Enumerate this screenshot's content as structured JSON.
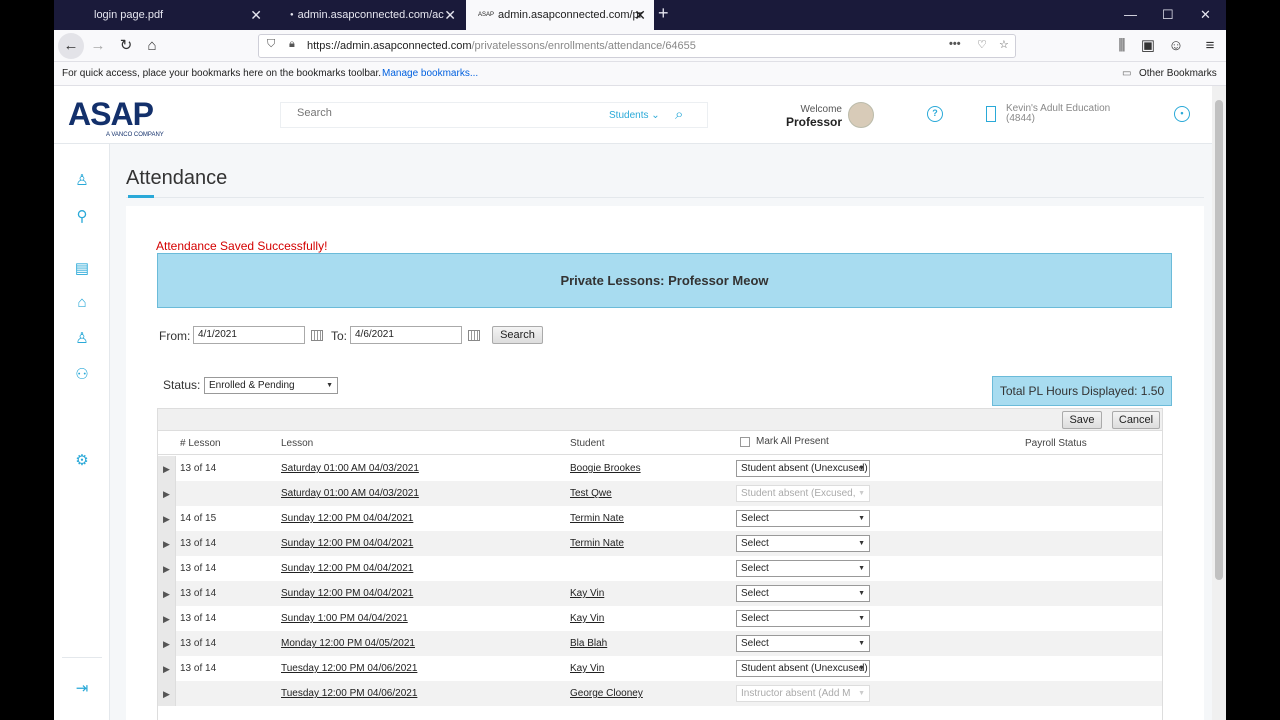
{
  "browser": {
    "tabs": [
      {
        "label": "login page.pdf"
      },
      {
        "label": "admin.asapconnected.com/ac"
      },
      {
        "label": "admin.asapconnected.com/pr"
      }
    ],
    "url_domain": "https://admin.asapconnected.com",
    "url_path": "/privatelessons/enrollments/attendance/64655",
    "bookmarks_text": "For quick access, place your bookmarks here on the bookmarks toolbar.",
    "bookmarks_link": "Manage bookmarks...",
    "other_bookmarks": "Other Bookmarks"
  },
  "header": {
    "logo_main": "ASAP",
    "logo_sub": "A VANCO COMPANY",
    "search_placeholder": "Search",
    "search_category": "Students",
    "welcome_label": "Welcome",
    "user_name": "Professor",
    "org_name": "Kevin's Adult Education",
    "org_id": "(4844)"
  },
  "page": {
    "title": "Attendance",
    "saved_message": "Attendance Saved Successfully!",
    "banner": "Private Lessons: Professor Meow",
    "from_label": "From:",
    "from_value": "4/1/2021",
    "to_label": "To:",
    "to_value": "4/6/2021",
    "search_button": "Search",
    "status_label": "Status:",
    "status_value": "Enrolled & Pending",
    "total_hours": "Total PL Hours Displayed: 1.50",
    "save_button": "Save",
    "cancel_button": "Cancel"
  },
  "grid": {
    "columns": {
      "lesson_num": "# Lesson",
      "lesson": "Lesson",
      "student": "Student",
      "mark_all": "Mark All Present",
      "payroll": "Payroll Status"
    },
    "rows": [
      {
        "num": "13 of 14",
        "lesson": "Saturday 01:00 AM 04/03/2021",
        "student": "Boogie Brookes",
        "attendance": "Student absent (Unexcused)",
        "disabled": false
      },
      {
        "num": "",
        "lesson": "Saturday 01:00 AM 04/03/2021",
        "student": "Test Qwe",
        "attendance": "Student absent (Excused,",
        "disabled": true
      },
      {
        "num": "14 of 15",
        "lesson": "Sunday 12:00 PM 04/04/2021",
        "student": "Termin Nate",
        "attendance": "Select",
        "disabled": false
      },
      {
        "num": "13 of 14",
        "lesson": "Sunday 12:00 PM 04/04/2021",
        "student": "Termin Nate",
        "attendance": "Select",
        "disabled": false
      },
      {
        "num": "13 of 14",
        "lesson": "Sunday 12:00 PM 04/04/2021",
        "student": "",
        "attendance": "Select",
        "disabled": false
      },
      {
        "num": "13 of 14",
        "lesson": "Sunday 12:00 PM 04/04/2021",
        "student": "Kay Vin",
        "attendance": "Select",
        "disabled": false
      },
      {
        "num": "13 of 14",
        "lesson": "Sunday 1:00 PM 04/04/2021",
        "student": "Kay Vin",
        "attendance": "Select",
        "disabled": false
      },
      {
        "num": "13 of 14",
        "lesson": "Monday 12:00 PM 04/05/2021",
        "student": "Bla Blah",
        "attendance": "Select",
        "disabled": false
      },
      {
        "num": "13 of 14",
        "lesson": "Tuesday 12:00 PM 04/06/2021",
        "student": "Kay Vin",
        "attendance": "Student absent (Unexcused)",
        "disabled": false
      },
      {
        "num": "",
        "lesson": "Tuesday 12:00 PM 04/06/2021",
        "student": "George Clooney",
        "attendance": "Instructor absent (Add M",
        "disabled": true
      }
    ]
  }
}
